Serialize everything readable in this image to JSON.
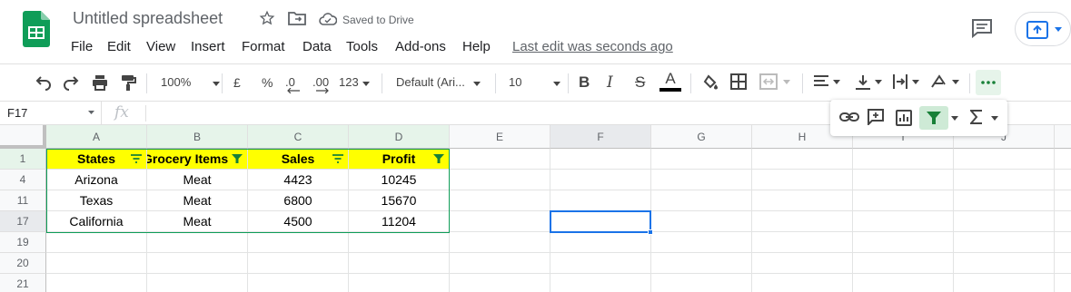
{
  "header": {
    "title": "Untitled spreadsheet",
    "saved_status": "Saved to Drive",
    "last_edit": "Last edit was seconds ago",
    "menu": [
      "File",
      "Edit",
      "View",
      "Insert",
      "Format",
      "Data",
      "Tools",
      "Add-ons",
      "Help"
    ]
  },
  "toolbar": {
    "zoom": "100%",
    "currency": "£",
    "percent": "%",
    "decrease_decimals": ".0",
    "increase_decimals": ".00",
    "more_formats": "123",
    "font": "Default (Ari...",
    "font_size": "10",
    "bold": "B",
    "italic": "I",
    "strike": "S",
    "text_color": "A"
  },
  "formula_bar": {
    "name_box": "F17",
    "fx": "fx",
    "value": ""
  },
  "grid": {
    "columns": [
      "A",
      "B",
      "C",
      "D",
      "E",
      "F",
      "G",
      "H",
      "I",
      "J"
    ],
    "rows": [
      "1",
      "4",
      "11",
      "17",
      "19",
      "20",
      "21"
    ],
    "header_row": [
      "States",
      "Grocery Items",
      "Sales",
      "Profit"
    ],
    "data": [
      [
        "Arizona",
        "Meat",
        "4423",
        "10245"
      ],
      [
        "Texas",
        "Meat",
        "6800",
        "15670"
      ],
      [
        "California",
        "Meat",
        "4500",
        "11204"
      ]
    ],
    "selected_cell": "F17"
  },
  "colors": {
    "header_fill": "#ffff00",
    "filter_green": "#188038",
    "selection_blue": "#1a73e8",
    "filter_range_border": "#0f9d58"
  }
}
